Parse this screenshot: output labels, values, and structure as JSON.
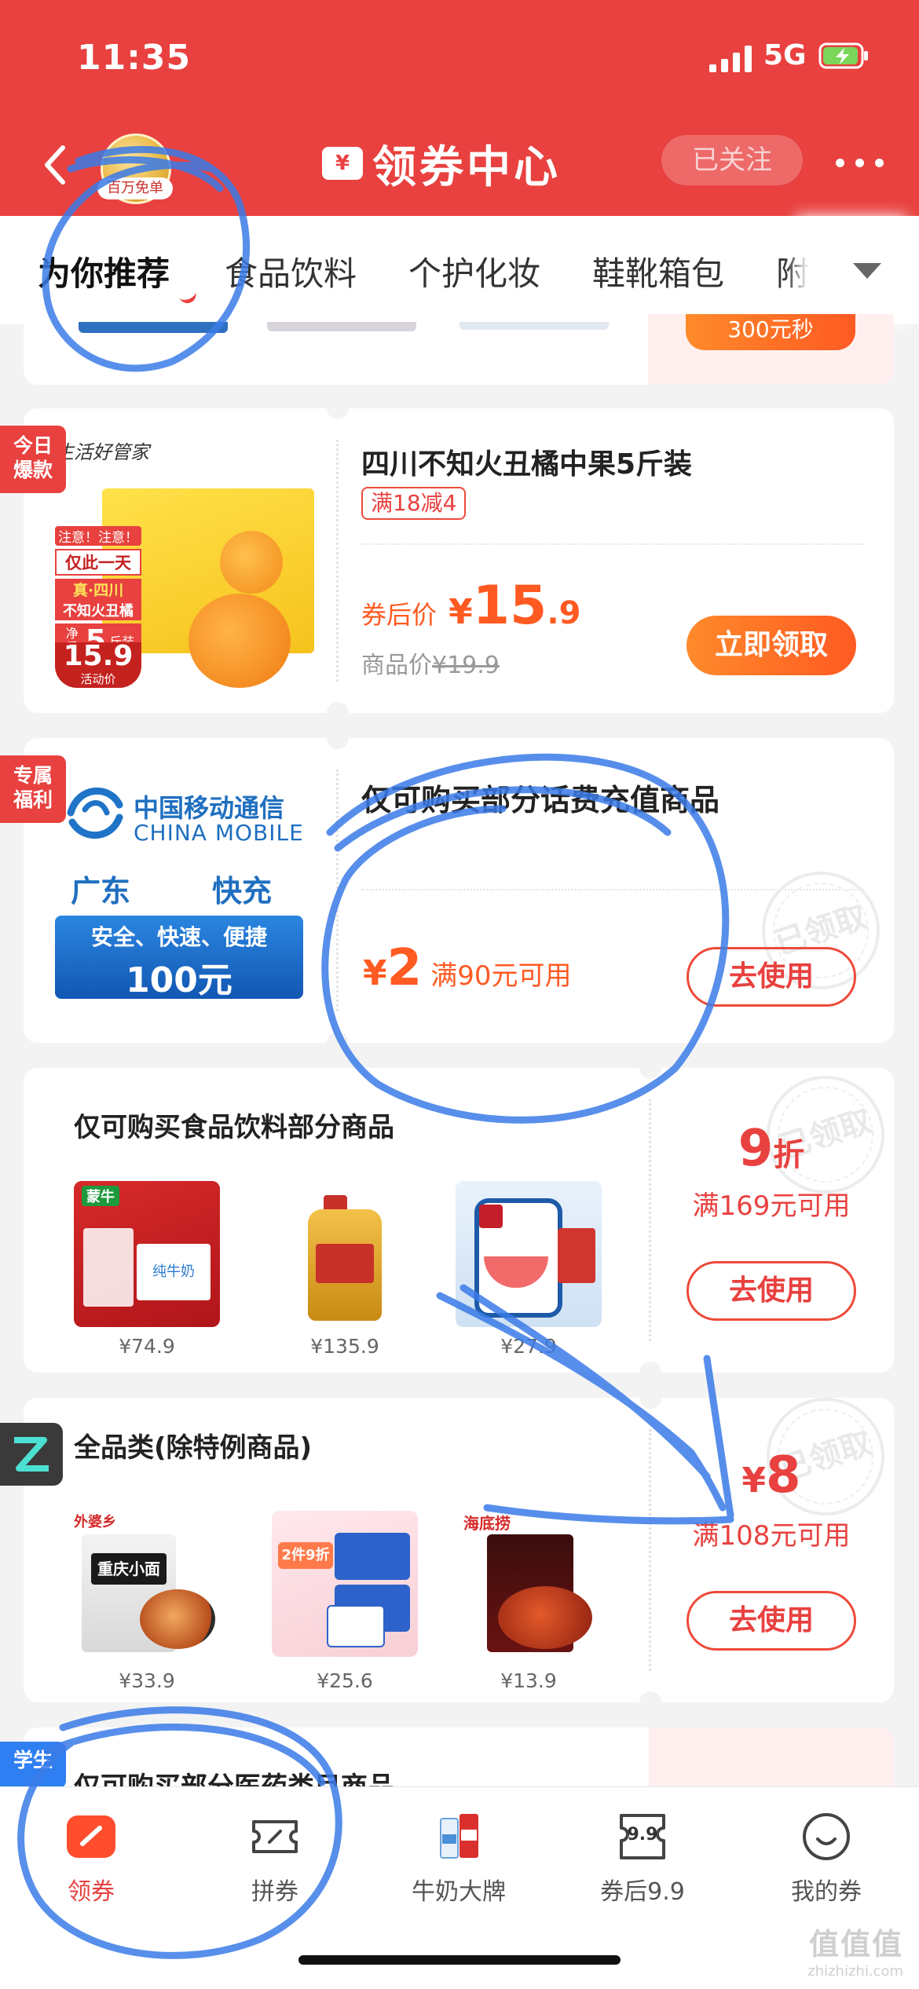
{
  "status_bar": {
    "time": "11:35",
    "network": "5G"
  },
  "header": {
    "avatar_badge": "百万免单",
    "title_icon": "¥",
    "title": "领券中心",
    "follow_label": "已关注"
  },
  "tabs": [
    "为你推荐",
    "食品饮料",
    "个护化妆",
    "鞋靴箱包",
    "附"
  ],
  "top_partial_card": {
    "button": "300元秒"
  },
  "card1": {
    "ribbon": "今日\n爆款",
    "brand_text": "生活好管家",
    "img_tag_1": "注意！注意！",
    "img_tag_2": "仅此一天",
    "img_tag_3": "真·四川",
    "img_tag_4": "不知火丑橘",
    "img_tag_5": "净重",
    "img_tag_6": "5",
    "img_tag_7": "斤装",
    "img_price": "15.9",
    "img_price_label": "活动价",
    "title": "四川不知火丑橘中果5斤装",
    "badge": "满18减4",
    "after_price_label": "券后价",
    "currency": "¥",
    "after_price_int": "15",
    "after_price_dec": ".9",
    "orig_price_label": "商品价",
    "orig_price": "¥19.9",
    "button": "立即领取"
  },
  "card2": {
    "ribbon": "专属\n福利",
    "logo_cn": "中国移动通信",
    "logo_en": "CHINA MOBILE",
    "region": "广东",
    "speed": "快充",
    "slogan": "安全、快速、便捷",
    "amount": "100元",
    "title": "仅可购买部分话费充值商品",
    "currency": "¥",
    "value": "2",
    "condition": "满90元可用",
    "stamp": "已领取",
    "button": "去使用"
  },
  "card3": {
    "title": "仅可购买食品饮料部分商品",
    "products": [
      {
        "price": "¥74.9",
        "brand": "蒙牛",
        "line1": "纯牛奶"
      },
      {
        "price": "¥135.9"
      },
      {
        "price": "¥27.9"
      }
    ],
    "discount_value": "9",
    "discount_unit": "折",
    "condition": "满169元可用",
    "stamp": "已领取",
    "button": "去使用"
  },
  "card4": {
    "title": "全品类(除特例商品)",
    "products": [
      {
        "price": "¥33.9",
        "brand": "外婆乡",
        "line1": "重庆小面"
      },
      {
        "price": "¥25.6",
        "line1": "2件9折"
      },
      {
        "price": "¥13.9",
        "brand": "海底捞"
      }
    ],
    "currency": "¥",
    "value": "8",
    "condition": "满108元可用",
    "stamp": "已领取",
    "button": "去使用"
  },
  "card5": {
    "ribbon": "学生",
    "title": "仅可购买部分医药类目商品"
  },
  "bottom_nav": [
    {
      "label": "领券",
      "icon": "coupon-icon"
    },
    {
      "label": "拼券",
      "icon": "ticket-icon"
    },
    {
      "label": "牛奶大牌",
      "icon": "milk-icon"
    },
    {
      "label": "券后9.9",
      "icon": "price-tag-icon",
      "icon_text": "9.9"
    },
    {
      "label": "我的券",
      "icon": "smile-icon"
    }
  ],
  "watermark": {
    "line1": "值值值",
    "line2": "zhizhizhi.com"
  },
  "colors": {
    "brand_red": "#e8413f",
    "orange": "#ff5a22",
    "blue_annotation": "#3a7be8"
  }
}
